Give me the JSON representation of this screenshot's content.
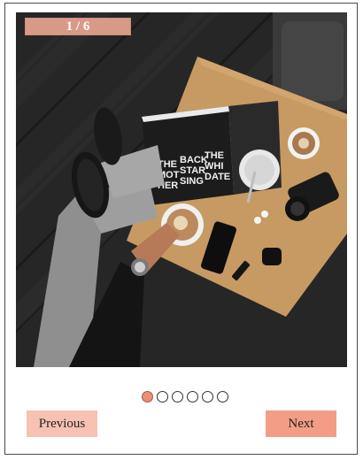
{
  "slideshow": {
    "counter": "1 / 6",
    "current": 1,
    "total": 6,
    "image_subject": "overhead photo of person with coffee, magazine, camera and phone on wooden table",
    "dots": [
      {
        "active": true
      },
      {
        "active": false
      },
      {
        "active": false
      },
      {
        "active": false
      },
      {
        "active": false
      },
      {
        "active": false
      }
    ],
    "prev_label": "Previous",
    "next_label": "Next"
  },
  "colors": {
    "accent": "#f39d86",
    "accent_light": "#f7c1b3",
    "dot_active": "#ef8f72"
  }
}
